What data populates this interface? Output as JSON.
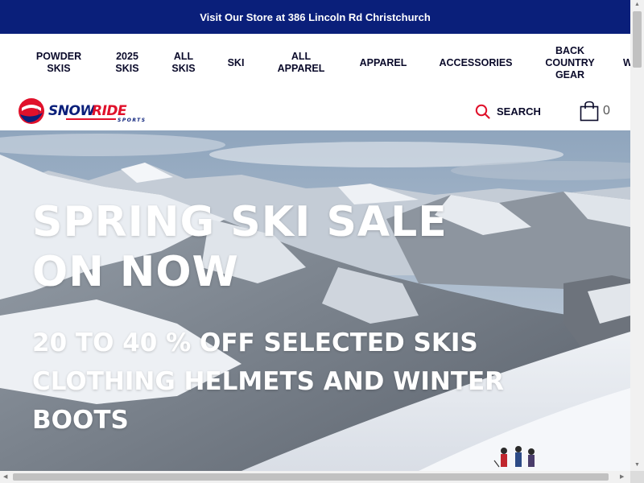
{
  "announcement": "Visit Our Store at 386 Lincoln Rd Christchurch",
  "nav": {
    "items": [
      {
        "label": "POWDER\nSKIS"
      },
      {
        "label": "2025\nSKIS"
      },
      {
        "label": "ALL\nSKIS"
      },
      {
        "label": "SKI"
      },
      {
        "label": "ALL\nAPPAREL"
      },
      {
        "label": "APPAREL"
      },
      {
        "label": "ACCESSORIES"
      },
      {
        "label": "BACK\nCOUNTRY\nGEAR"
      },
      {
        "label": "W"
      }
    ]
  },
  "brand": {
    "name": "SNOWRIDE",
    "tagline": "SPORTS",
    "colors": {
      "red": "#e0112b",
      "navy": "#0a1f7a"
    }
  },
  "search": {
    "label": "SEARCH",
    "icon": "search-icon"
  },
  "cart": {
    "count": "0",
    "icon": "cart-icon"
  },
  "hero": {
    "title": "SPRING SKI SALE\nON NOW",
    "subtitle": "20 TO 40 % OFF SELECTED SKIS CLOTHING HELMETS AND WINTER BOOTS"
  }
}
